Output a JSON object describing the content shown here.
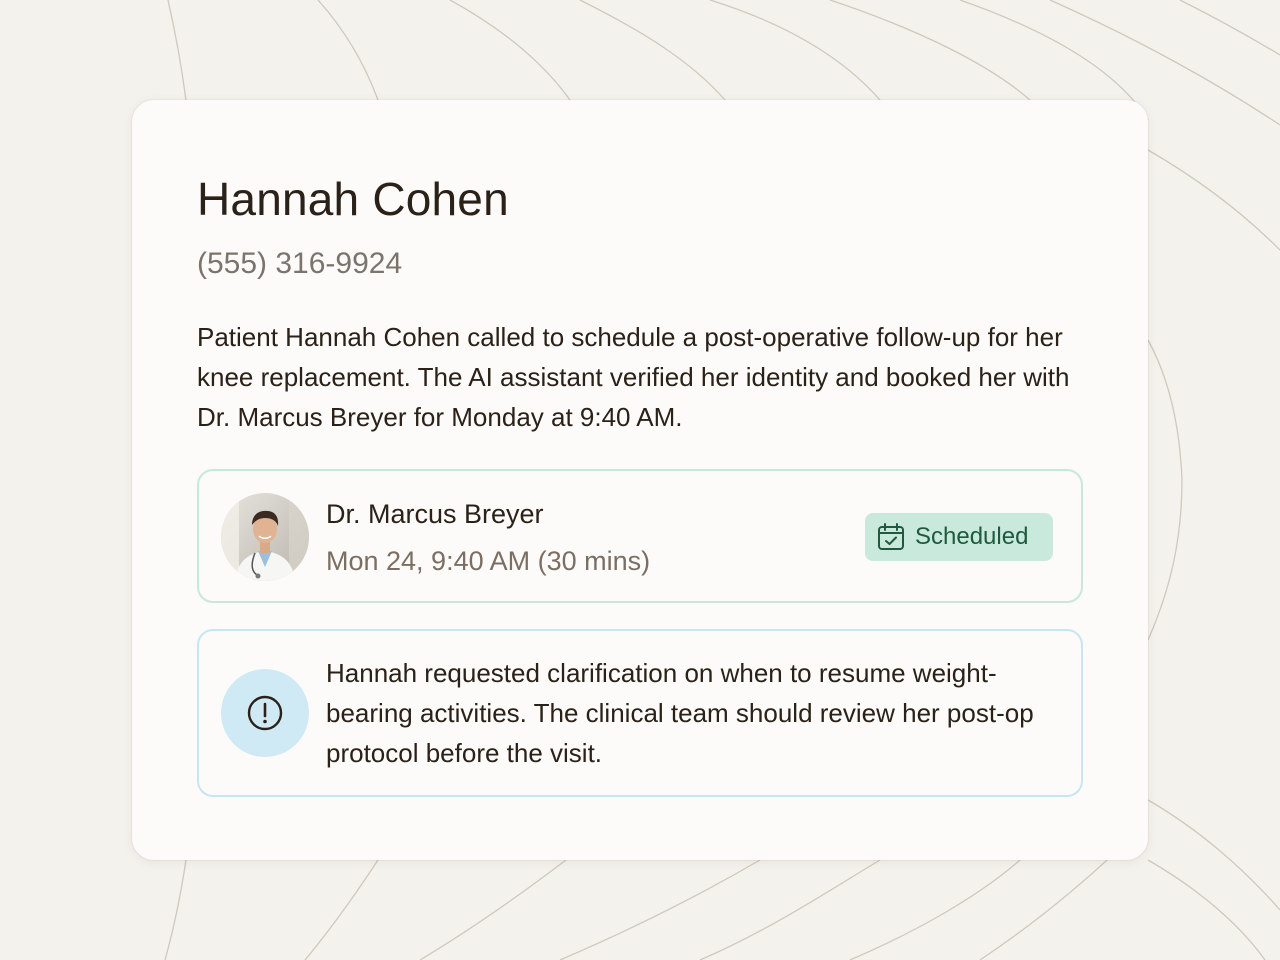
{
  "patient": {
    "name": "Hannah Cohen",
    "phone": "(555) 316-9924",
    "summary": "Patient Hannah Cohen called to schedule a post-operative follow-up for her knee replacement. The AI assistant verified her identity and booked her with Dr. Marcus Breyer for Monday at 9:40 AM."
  },
  "appointment": {
    "doctor": "Dr. Marcus Breyer",
    "time": "Mon 24, 9:40 AM (30 mins)",
    "status": "Scheduled",
    "status_icon": "calendar-check-icon",
    "avatar_icon": "doctor-avatar"
  },
  "note": {
    "icon": "alert-circle-icon",
    "text": "Hannah requested clarification on when to resume weight-bearing activities. The clinical team should review her post-op protocol before the visit."
  },
  "colors": {
    "background": "#f4f2ec",
    "card": "#fcfbf9",
    "text": "#2a2118",
    "muted": "#7b746c",
    "badge_bg": "#c9e9dc",
    "badge_text": "#1e5a3e",
    "appt_border": "#c6e8de",
    "note_border": "#c8e6f0",
    "alert_bg": "#cfeaf5"
  }
}
